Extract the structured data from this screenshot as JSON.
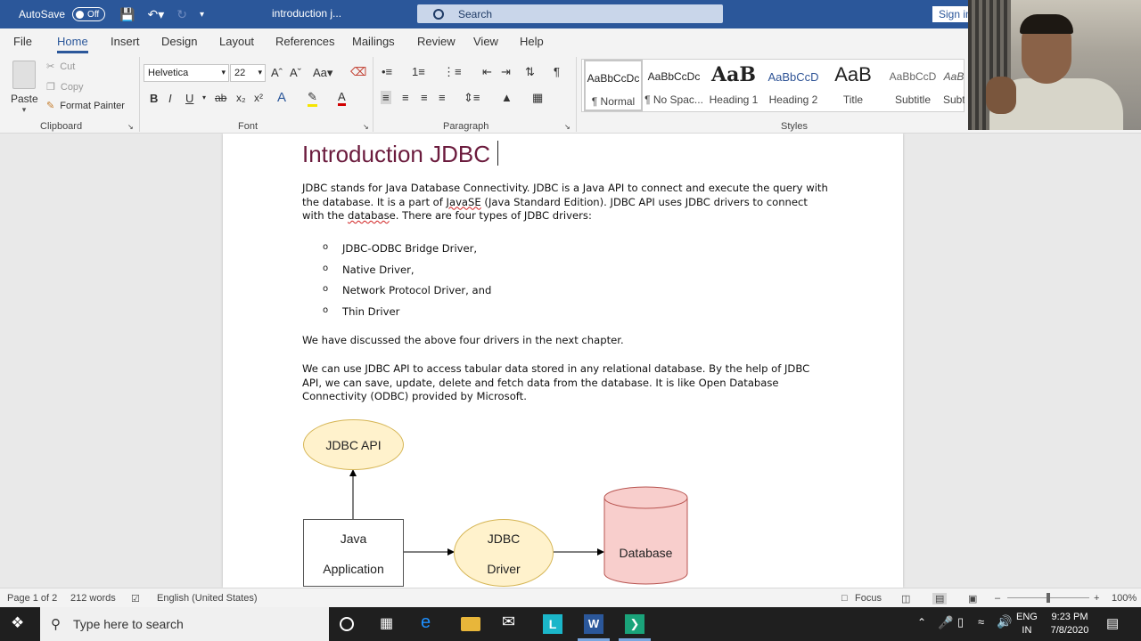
{
  "titlebar": {
    "autosave_label": "AutoSave",
    "autosave_state": "Off",
    "document_title": "introduction j...",
    "search_label": "Search",
    "signin_label": "Sign in"
  },
  "tabs": [
    "File",
    "Home",
    "Insert",
    "Design",
    "Layout",
    "References",
    "Mailings",
    "Review",
    "View",
    "Help"
  ],
  "ribbon": {
    "clipboard": {
      "paste": "Paste",
      "cut": "Cut",
      "copy": "Copy",
      "format_painter": "Format Painter",
      "label": "Clipboard"
    },
    "font": {
      "family": "Helvetica",
      "size": "22",
      "label": "Font"
    },
    "paragraph": {
      "label": "Paragraph"
    },
    "styles": {
      "label": "Styles",
      "items": [
        {
          "preview": "AaBbCcDc",
          "name": "¶ Normal"
        },
        {
          "preview": "AaBbCcDc",
          "name": "¶ No Spac..."
        },
        {
          "preview": "AaB",
          "name": "Heading 1"
        },
        {
          "preview": "AaBbCcD",
          "name": "Heading 2"
        },
        {
          "preview": "AaB",
          "name": "Title"
        },
        {
          "preview": "AaBbCcD",
          "name": "Subtitle"
        },
        {
          "preview": "AaB",
          "name": "Subt"
        }
      ]
    }
  },
  "document": {
    "heading": "Introduction JDBC",
    "para1_a": "JDBC stands for Java Database Connectivity. JDBC is a Java API to connect and execute the query with the database. It is a part of ",
    "para1_squig": "JavaSE",
    "para1_b": " (Java Standard Edition). JDBC API uses JDBC drivers to connect with the ",
    "para1_squig2": "databas",
    "para1_c": "e. There are four types of JDBC drivers:",
    "bullets": [
      "JDBC-ODBC Bridge Driver,",
      "Native Driver,",
      "Network Protocol Driver, and",
      "Thin Driver"
    ],
    "para2": "We have discussed the above four drivers in the next chapter.",
    "para3": "We can use JDBC API to access tabular data stored in any relational database. By the help of JDBC API, we can save, update, delete and fetch data from the database. It is like Open Database Connectivity (ODBC) provided by Microsoft.",
    "diagram": {
      "api": "JDBC API",
      "app_line1": "Java",
      "app_line2": "Application",
      "driver_line1": "JDBC",
      "driver_line2": "Driver",
      "database": "Database"
    }
  },
  "statusbar": {
    "page": "Page 1 of 2",
    "words": "212 words",
    "language": "English (United States)",
    "focus": "Focus",
    "zoom": "100%"
  },
  "taskbar": {
    "search_placeholder": "Type here to search",
    "lang_line1": "ENG",
    "lang_line2": "IN",
    "time": "9:23 PM",
    "date": "7/8/2020"
  }
}
